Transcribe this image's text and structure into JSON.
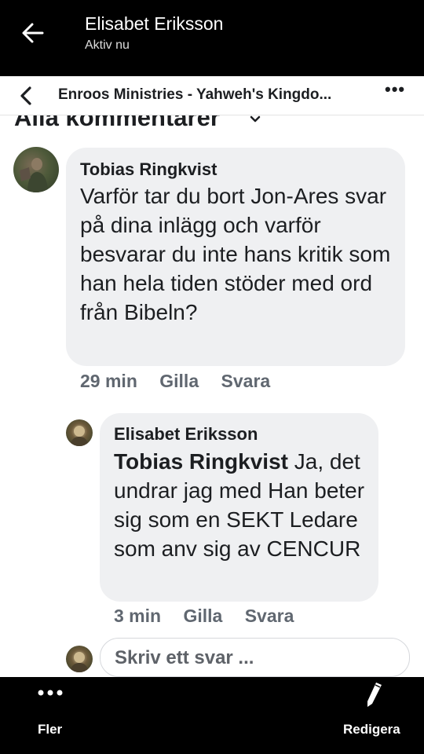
{
  "header": {
    "title": "Elisabet Eriksson",
    "subtitle": "Aktiv nu",
    "back_icon": "arrow-left-icon"
  },
  "post_bar": {
    "title": "Enroos Ministries - Yahweh's Kingdo...",
    "more": "•••"
  },
  "comments_section": {
    "label": "Alla kommentarer"
  },
  "comments": [
    {
      "author": "Tobias Ringkvist",
      "text": "Varför tar du bort Jon-Ares svar på dina inlägg och varför besvarar du inte hans kritik som han hela tiden stöder med ord från Bibeln?",
      "time": "29 min",
      "like": "Gilla",
      "reply": "Svara"
    },
    {
      "author": "Elisabet Eriksson",
      "mention": "Tobias Ringkvist",
      "text": " Ja, det undrar jag med Han beter sig som en SEKT Ledare som anv sig av CENCUR",
      "time": "3 min",
      "like": "Gilla",
      "reply": "Svara"
    }
  ],
  "reply_box": {
    "placeholder": "Skriv ett svar ..."
  },
  "bottom_bar": {
    "more_label": "Fler",
    "edit_label": "Redigera"
  }
}
